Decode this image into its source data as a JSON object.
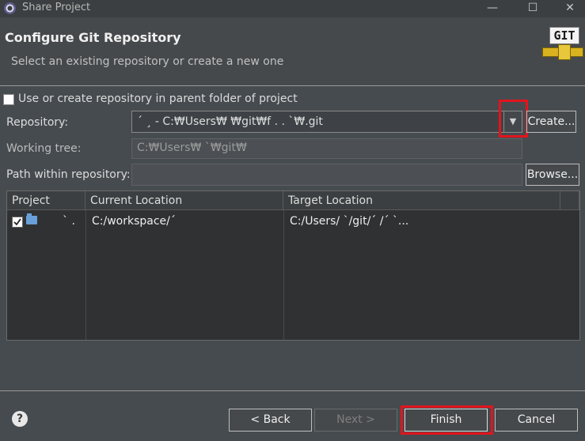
{
  "window": {
    "title": "Share Project",
    "minimize": "—",
    "maximize": "☐",
    "close": "✕"
  },
  "header": {
    "title": "Configure Git Repository",
    "subtitle": "Select an existing repository or create a new one",
    "logo_text": "GIT"
  },
  "parent_option": {
    "label": "Use or create repository in parent folder of project",
    "checked": false
  },
  "repository": {
    "label": "Repository:",
    "value": "´ ¸ - C:₩Users₩ ₩git₩f . . `₩.git",
    "create_label": "Create..."
  },
  "working_tree": {
    "label": "Working tree:",
    "value": "C:₩Users₩ `₩git₩"
  },
  "path_within": {
    "label": "Path within repository:",
    "value": "",
    "browse_label": "Browse..."
  },
  "table": {
    "headers": [
      "Project",
      "Current Location",
      "Target Location"
    ],
    "rows": [
      {
        "project": "` .",
        "current": "C:/workspace/´",
        "target": "C:/Users/ `/git/´ /´ `...",
        "checked": true
      }
    ]
  },
  "footer": {
    "help_icon": "?",
    "back_label": "< Back",
    "next_label": "Next >",
    "finish_label": "Finish",
    "cancel_label": "Cancel"
  },
  "colors": {
    "highlight": "#e2141d",
    "background": "#464b4f"
  }
}
